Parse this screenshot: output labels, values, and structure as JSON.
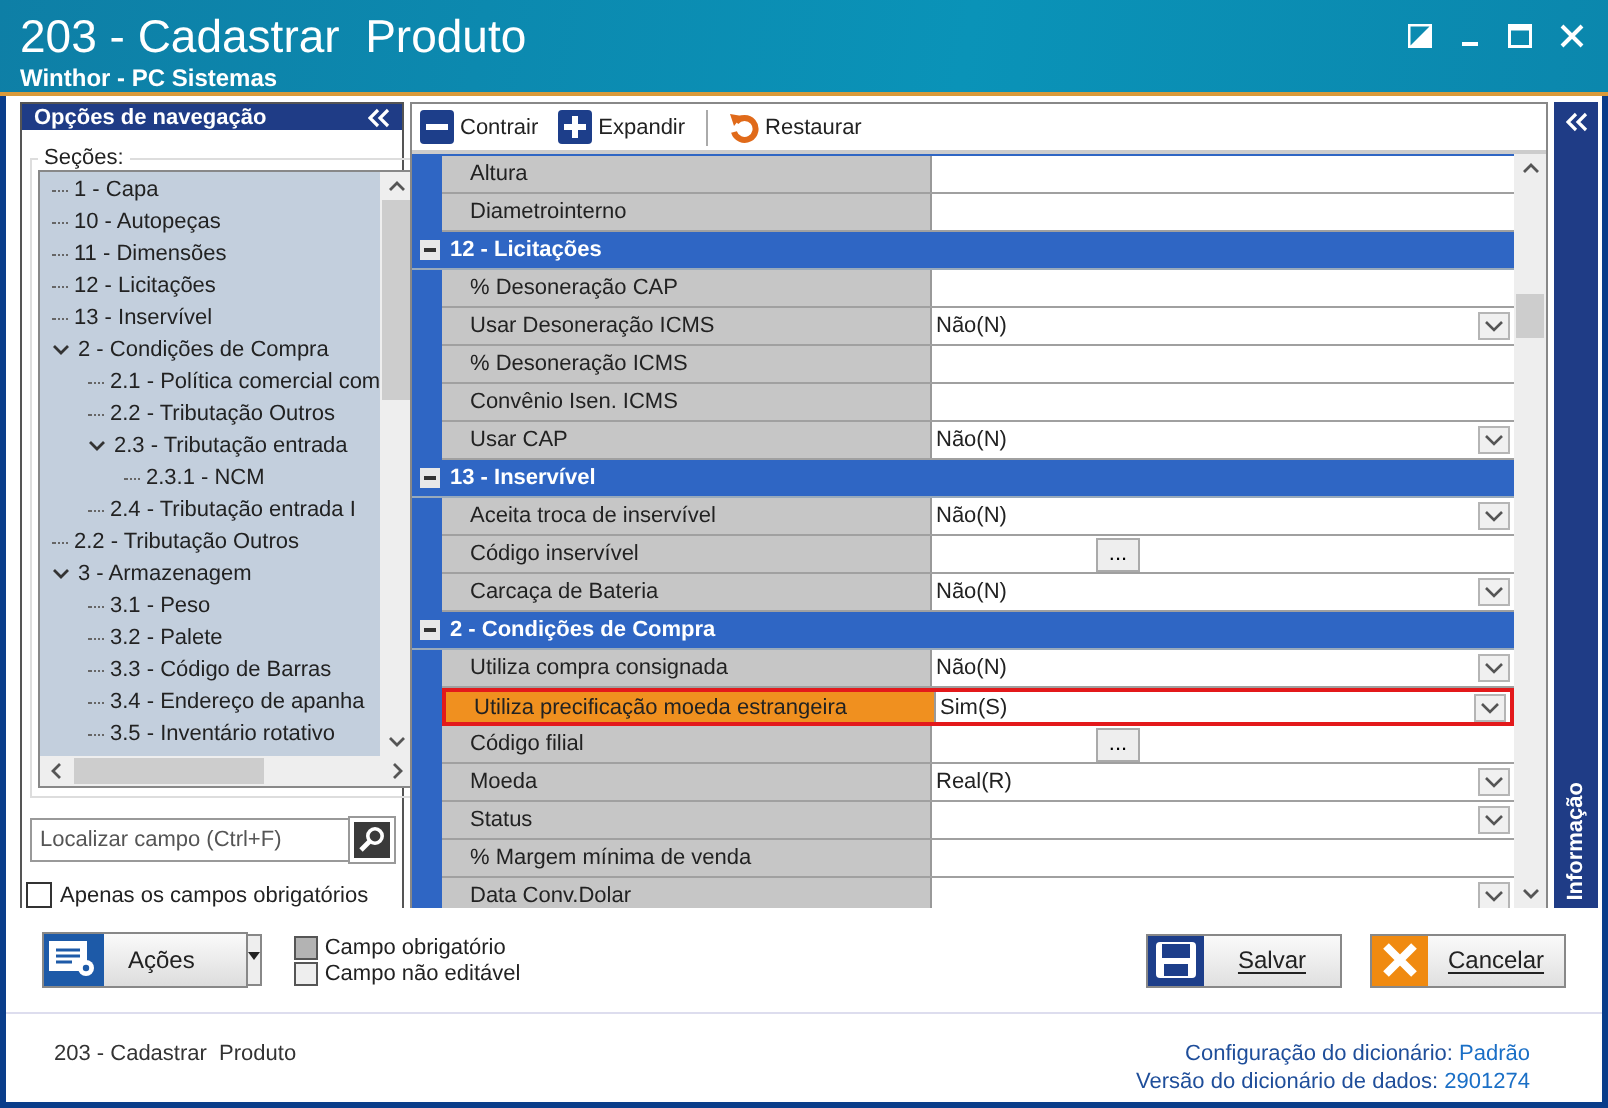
{
  "window": {
    "title": "203 - Cadastrar  Produto",
    "subtitle": "Winthor - PC Sistemas"
  },
  "navigation": {
    "title": "Opções de navegação",
    "group_label": "Seções:",
    "tree": [
      {
        "label": "1 - Capa"
      },
      {
        "label": "10 - Autopeças"
      },
      {
        "label": "11 - Dimensões"
      },
      {
        "label": "12 - Licitações"
      },
      {
        "label": "13 - Inservível"
      },
      {
        "label": "2 - Condições de Compra",
        "expanded": true,
        "children": [
          {
            "label": "2.1 - Política comercial com"
          },
          {
            "label": "2.2 - Tributação Outros"
          },
          {
            "label": "2.3 - Tributação entrada",
            "expanded": true,
            "children": [
              {
                "label": "2.3.1 - NCM"
              }
            ]
          },
          {
            "label": "2.4 - Tributação entrada I"
          }
        ]
      },
      {
        "label": "2.2 - Tributação Outros"
      },
      {
        "label": "3 - Armazenagem",
        "expanded": true,
        "children": [
          {
            "label": "3.1 - Peso"
          },
          {
            "label": "3.2 - Palete"
          },
          {
            "label": "3.3 - Código de Barras"
          },
          {
            "label": "3.4 - Endereço de apanha"
          },
          {
            "label": "3.5 - Inventário rotativo"
          }
        ]
      }
    ],
    "search": {
      "placeholder": "Localizar campo (Ctrl+F)"
    },
    "required_only": {
      "label": "Apenas os campos obrigatórios",
      "checked": false
    }
  },
  "toolbar": [
    "Contrair",
    "Expandir",
    "Restaurar"
  ],
  "sections": [
    {
      "rows": [
        {
          "label": "Altura",
          "kind": "text",
          "selected": false
        },
        {
          "label": "Diametrointerno",
          "kind": "text",
          "selected": false
        }
      ]
    },
    {
      "title": "12 - Licitações",
      "rows": [
        {
          "label": "% Desoneração CAP",
          "kind": "text",
          "selected": false
        },
        {
          "label": "Usar Desoneração ICMS",
          "kind": "combo",
          "value": "Não(N)",
          "selected": false
        },
        {
          "label": "% Desoneração ICMS",
          "kind": "text",
          "selected": false
        },
        {
          "label": "Convênio Isen. ICMS",
          "kind": "text",
          "selected": false
        },
        {
          "label": "Usar CAP",
          "kind": "combo",
          "value": "Não(N)",
          "selected": false
        }
      ]
    },
    {
      "title": "13 - Inservível",
      "rows": [
        {
          "label": "Aceita troca de inservível",
          "kind": "combo",
          "value": "Não(N)",
          "selected": false
        },
        {
          "label": "Código inservível",
          "kind": "lookup",
          "button": "...",
          "selected": false
        },
        {
          "label": "Carcaça de Bateria",
          "kind": "combo",
          "value": "Não(N)",
          "selected": false
        }
      ]
    },
    {
      "title": "2 - Condições de Compra",
      "rows": [
        {
          "label": "Utiliza compra consignada",
          "kind": "combo",
          "value": "Não(N)",
          "selected": false
        },
        {
          "label": "Utiliza precificação moeda estrangeira",
          "kind": "combo",
          "value": "Sim(S)",
          "selected": true
        },
        {
          "label": "Código filial",
          "kind": "lookup",
          "button": "...",
          "selected": false
        },
        {
          "label": "Moeda",
          "kind": "combo",
          "value": "Real(R)",
          "selected": false
        },
        {
          "label": "Status",
          "kind": "combo",
          "selected": false
        },
        {
          "label": "% Margem mínima de venda",
          "kind": "text",
          "selected": false
        },
        {
          "label": "Data Conv.Dolar",
          "kind": "combo",
          "selected": false
        }
      ]
    }
  ],
  "info_panel": {
    "label": "Informação"
  },
  "actions_button": "Ações",
  "legend": [
    "Campo obrigatório",
    "Campo não editável"
  ],
  "buttons": [
    "Salvar",
    "Cancelar"
  ],
  "status_bar": {
    "screen": "203 - Cadastrar  Produto",
    "items": [
      {
        "label": "Configuração do dicionário:",
        "value": "Padrão"
      },
      {
        "label": "Versão do dicionário de dados:",
        "value": "2901274"
      }
    ]
  }
}
